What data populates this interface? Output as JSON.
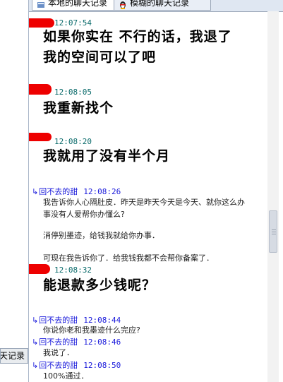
{
  "tabs": [
    {
      "label": "本地的聊天记录"
    },
    {
      "label": "模糊的聊天记录"
    }
  ],
  "left_button": {
    "label": "天记录"
  },
  "messages": [
    {
      "time": "12:07:54",
      "text1": "如果你实在 不行的话，我退了",
      "text2": "我的空间可以了吧"
    },
    {
      "time": "12:08:05",
      "text1": "我重新找个"
    },
    {
      "time": "12:08:20",
      "text1": "我就用了没有半个月"
    },
    {
      "sender": "回不去的甜",
      "time": "12:08:26",
      "line1": "我告诉你人心隔肚皮．昨天是昨天今天是今天、就你这么办",
      "line2": "事没有人爱帮你办懂么?",
      "line3": "消停别墨迹，给钱我就给你办事．",
      "line4": "可现在我告诉你了．给我钱我都不会帮你备案了．"
    },
    {
      "time": "12:08:32",
      "text1": "能退款多少钱呢？"
    },
    {
      "sender": "回不去的甜",
      "time": "12:08:44",
      "line1": "你说你老和我墨迹什么完应?"
    },
    {
      "sender": "回不去的甜",
      "time": "12:08:46",
      "line1": "我说了．"
    },
    {
      "sender": "回不去的甜",
      "time": "12:08:50",
      "line1": "100%通过．"
    }
  ],
  "colors": {
    "redaction": "#ee0000",
    "sender": "#1a1adb",
    "self_time": "#0a6b6b"
  }
}
